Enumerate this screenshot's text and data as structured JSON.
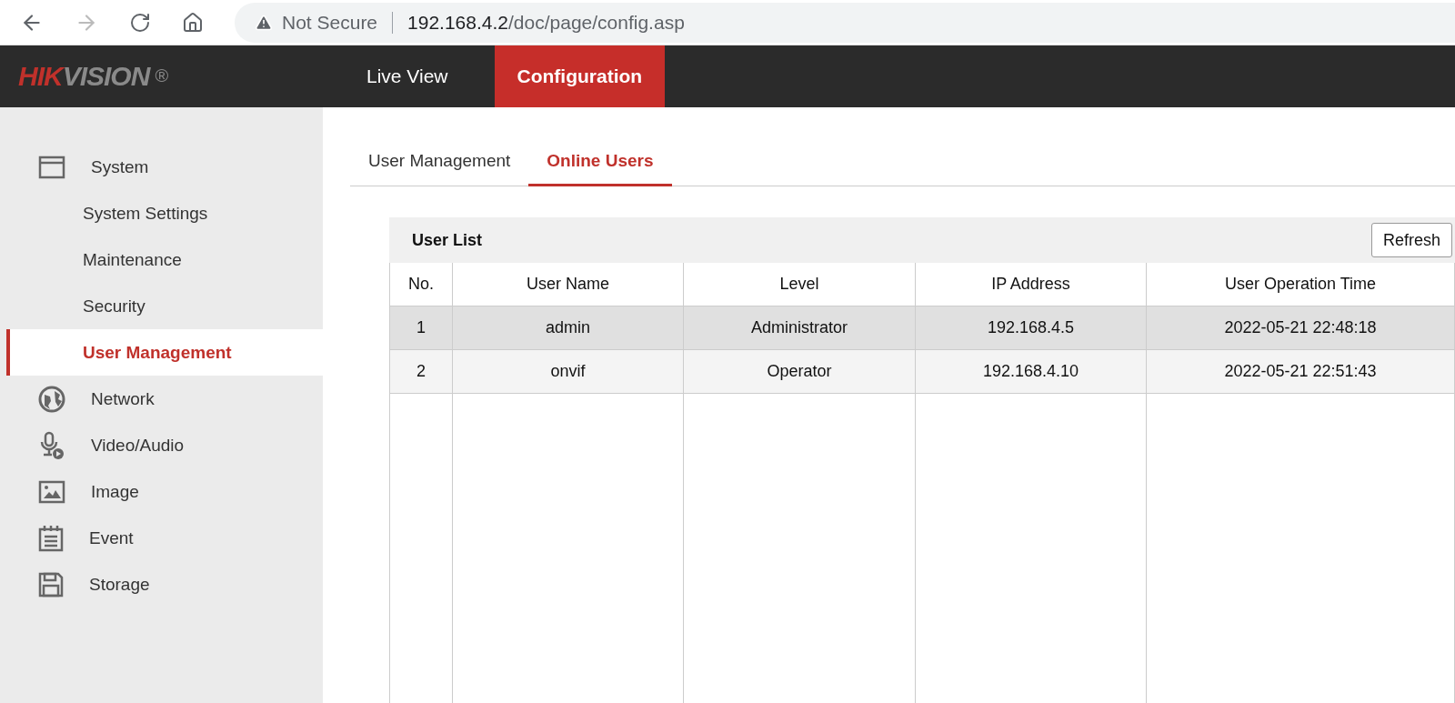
{
  "browser": {
    "security": "Not Secure",
    "host": "192.168.4.2",
    "path": "/doc/page/config.asp"
  },
  "logo": {
    "first": "HIK",
    "second": "VISION",
    "mark": "®"
  },
  "nav": [
    {
      "label": "Live View",
      "selected": false
    },
    {
      "label": "Configuration",
      "selected": true
    }
  ],
  "sidebar": {
    "items": [
      {
        "label": "System",
        "children": [
          {
            "label": "System Settings",
            "selected": false
          },
          {
            "label": "Maintenance",
            "selected": false
          },
          {
            "label": "Security",
            "selected": false
          },
          {
            "label": "User Management",
            "selected": true
          }
        ]
      },
      {
        "label": "Network"
      },
      {
        "label": "Video/Audio"
      },
      {
        "label": "Image"
      },
      {
        "label": "Event"
      },
      {
        "label": "Storage"
      }
    ]
  },
  "tabs": [
    {
      "label": "User Management",
      "selected": false
    },
    {
      "label": "Online Users",
      "selected": true
    }
  ],
  "panel": {
    "title": "User List",
    "button": "Refresh"
  },
  "table": {
    "columns": [
      "No.",
      "User Name",
      "Level",
      "IP Address",
      "User Operation Time"
    ],
    "rows": [
      {
        "cells": [
          "1",
          "admin",
          "Administrator",
          "192.168.4.5",
          "2022-05-21 22:48:18"
        ],
        "selected": true
      },
      {
        "cells": [
          "2",
          "onvif",
          "Operator",
          "192.168.4.10",
          "2022-05-21 22:51:43"
        ],
        "selected": false
      }
    ]
  }
}
